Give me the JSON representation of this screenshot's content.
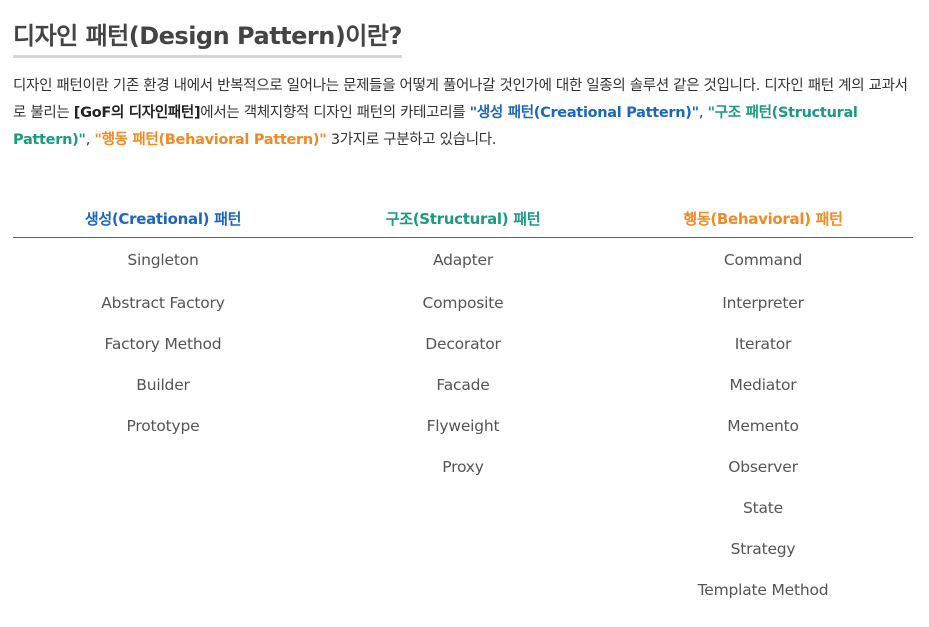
{
  "title": "디자인 패턴(Design Pattern)이란?",
  "intro": {
    "p1": "디자인 패턴이란 기존 환경 내에서 반복적으로 일어나는 문제들을 어떻게 풀어나갈 것인가에 대한 일종의 솔루션 같은 것입니다. 디자인 패턴 계의 교과서로 불리는 ",
    "gof": "[GoF의 디자인패턴]",
    "p2": "에서는 객체지향적 디자인 패턴의 카테고리를 ",
    "creational": "\"생성 패턴(Creational Pattern)\"",
    "sep1": ", ",
    "structural": "\"구조 패턴(Structural Pattern)\"",
    "sep2": ", ",
    "behavioral": "\"행동 패턴(Behavioral Pattern)\"",
    "p3": " 3가지로 구분하고 있습니다."
  },
  "colors": {
    "creational": "#1a66c2",
    "structural": "#1a9a7f",
    "behavioral": "#f08a24"
  },
  "table": {
    "headers": [
      "생성(Creational) 패턴",
      "구조(Structural) 패턴",
      "행동(Behavioral) 패턴"
    ],
    "rows": [
      [
        "Singleton",
        "Adapter",
        "Command"
      ],
      [
        "Abstract Factory",
        "Composite",
        "Interpreter"
      ],
      [
        "Factory Method",
        "Decorator",
        "Iterator"
      ],
      [
        "Builder",
        "Facade",
        "Mediator"
      ],
      [
        "Prototype",
        "Flyweight",
        "Memento"
      ],
      [
        "",
        "Proxy",
        "Observer"
      ],
      [
        "",
        "",
        "State"
      ],
      [
        "",
        "",
        "Strategy"
      ],
      [
        "",
        "",
        "Template Method"
      ]
    ]
  }
}
